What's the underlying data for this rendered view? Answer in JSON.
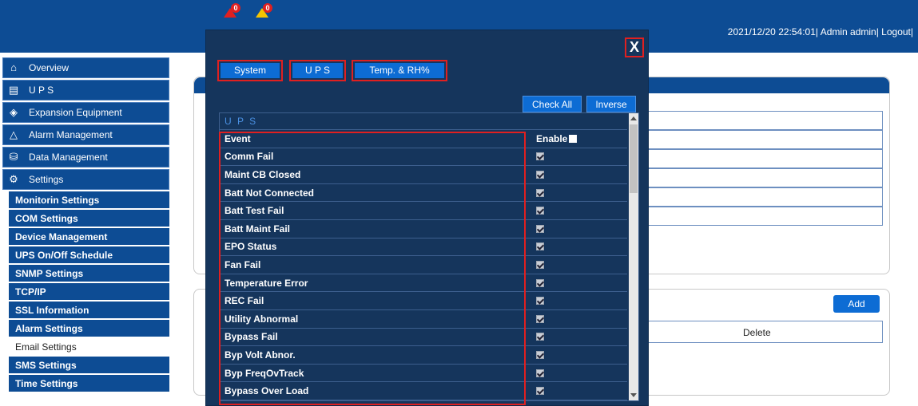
{
  "header": {
    "alarm_red_count": "0",
    "alarm_yellow_count": "0",
    "user_info": "2021/12/20 22:54:01| Admin admin| Logout|"
  },
  "sidebar": {
    "items": [
      {
        "label": "Overview",
        "icon": "home-icon"
      },
      {
        "label": "U P S",
        "icon": "ups-icon"
      },
      {
        "label": "Expansion Equipment",
        "icon": "expansion-icon"
      },
      {
        "label": "Alarm Management",
        "icon": "warning-icon"
      },
      {
        "label": "Data Management",
        "icon": "database-icon"
      },
      {
        "label": "Settings",
        "icon": "gear-icon"
      }
    ],
    "sub_items": [
      "Monitorin Settings",
      "COM Settings",
      "Device Management",
      "UPS On/Off Schedule",
      "SNMP Settings",
      "TCP/IP",
      "SSL Information",
      "Alarm Settings",
      "Email Settings",
      "SMS Settings",
      "Time Settings"
    ]
  },
  "main": {
    "add_label": "Add",
    "delete_label": "Delete"
  },
  "modal": {
    "close_label": "X",
    "tabs": [
      "System",
      "U P S",
      "Temp. & RH%"
    ],
    "check_all_label": "Check All",
    "inverse_label": "Inverse",
    "section_title": "U P S",
    "col_event": "Event",
    "col_enable": "Enable",
    "events": [
      "Comm Fail",
      "Maint CB Closed",
      "Batt Not Connected",
      "Batt Test Fail",
      "Batt Maint Fail",
      "EPO Status",
      "Fan Fail",
      "Temperature Error",
      "REC Fail",
      "Utility Abnormal",
      "Bypass Fail",
      "Byp Volt Abnor.",
      "Byp FreqOvTrack",
      "Bypass Over Load"
    ]
  },
  "colors": {
    "header_blue": "#0d4c94",
    "modal_bg": "#15355c",
    "button_blue": "#0d6cd4",
    "highlight_red": "#e02020"
  }
}
